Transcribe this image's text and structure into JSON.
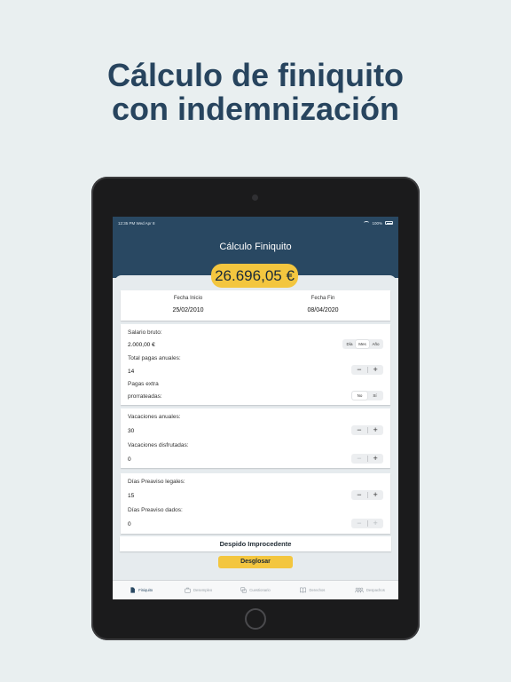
{
  "headline": {
    "line1": "Cálculo de finiquito",
    "line2": "con indemnización"
  },
  "status": {
    "time_date": "12:35 PM   Wed Apr 8",
    "battery": "100%"
  },
  "nav": {
    "title": "Cálculo Finiquito"
  },
  "amount": "26.696,05 €",
  "dates": {
    "start_label": "Fecha Inicio",
    "start_value": "25/02/2010",
    "end_label": "Fecha Fin",
    "end_value": "08/04/2020"
  },
  "salary": {
    "label": "Salario bruto:",
    "value": "2.000,00 €",
    "period_options": [
      "Día",
      "Mes",
      "Año"
    ],
    "period_selected": "Mes",
    "payments_label": "Total pagas anuales:",
    "payments_value": "14",
    "extra_label_1": "Pagas extra",
    "extra_label_2": "prorrateadas:",
    "extra_options": [
      "No",
      "Sí"
    ],
    "extra_selected": "No"
  },
  "vacation": {
    "annual_label": "Vacaciones anuales:",
    "annual_value": "30",
    "used_label": "Vacaciones disfrutadas:",
    "used_value": "0"
  },
  "notice": {
    "legal_label": "Días Preaviso legales:",
    "legal_value": "15",
    "given_label": "Días Preaviso dados:",
    "given_value": "0"
  },
  "stepper": {
    "minus": "−",
    "plus": "+"
  },
  "dismissal": "Despido Improcedente",
  "breakdown_button": "Desglosar",
  "tabs": [
    {
      "label": "Finiquito",
      "icon": "document-icon",
      "active": true
    },
    {
      "label": "Desempleo",
      "icon": "briefcase-icon",
      "active": false
    },
    {
      "label": "Cuestionario",
      "icon": "chat-icon",
      "active": false
    },
    {
      "label": "Derechos",
      "icon": "book-icon",
      "active": false
    },
    {
      "label": "Despachos",
      "icon": "people-icon",
      "active": false
    }
  ],
  "colors": {
    "background": "#e9eff0",
    "navy": "#294862",
    "accent": "#f3c63f",
    "headline": "#27445e"
  }
}
